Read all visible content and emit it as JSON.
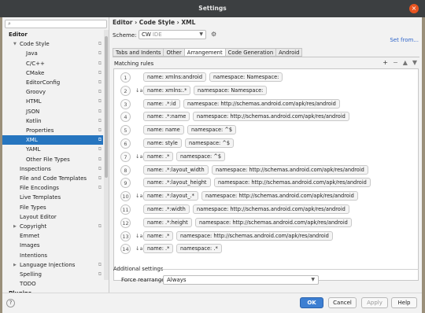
{
  "window": {
    "title": "Settings",
    "close_glyph": "×"
  },
  "sidebar": {
    "search_placeholder": "",
    "items": [
      {
        "label": "Editor",
        "level": 0,
        "bold": true
      },
      {
        "label": "Code Style",
        "level": 1,
        "expanded": true,
        "cfg": true
      },
      {
        "label": "Java",
        "level": 2,
        "cfg": true
      },
      {
        "label": "C/C++",
        "level": 2,
        "cfg": true
      },
      {
        "label": "CMake",
        "level": 2,
        "cfg": true
      },
      {
        "label": "EditorConfig",
        "level": 2,
        "cfg": true
      },
      {
        "label": "Groovy",
        "level": 2,
        "cfg": true
      },
      {
        "label": "HTML",
        "level": 2,
        "cfg": true
      },
      {
        "label": "JSON",
        "level": 2,
        "cfg": true
      },
      {
        "label": "Kotlin",
        "level": 2,
        "cfg": true
      },
      {
        "label": "Properties",
        "level": 2,
        "cfg": true
      },
      {
        "label": "XML",
        "level": 2,
        "cfg": true,
        "selected": true
      },
      {
        "label": "YAML",
        "level": 2,
        "cfg": true
      },
      {
        "label": "Other File Types",
        "level": 2,
        "cfg": true
      },
      {
        "label": "Inspections",
        "level": 1,
        "cfg": true
      },
      {
        "label": "File and Code Templates",
        "level": 1,
        "cfg": true
      },
      {
        "label": "File Encodings",
        "level": 1,
        "cfg": true
      },
      {
        "label": "Live Templates",
        "level": 1
      },
      {
        "label": "File Types",
        "level": 1
      },
      {
        "label": "Layout Editor",
        "level": 1
      },
      {
        "label": "Copyright",
        "level": 1,
        "collapsed": true,
        "cfg": true
      },
      {
        "label": "Emmet",
        "level": 1
      },
      {
        "label": "Images",
        "level": 1
      },
      {
        "label": "Intentions",
        "level": 1
      },
      {
        "label": "Language Injections",
        "level": 1,
        "collapsed": true,
        "cfg": true
      },
      {
        "label": "Spelling",
        "level": 1,
        "cfg": true
      },
      {
        "label": "TODO",
        "level": 1
      },
      {
        "label": "Plugins",
        "level": 0,
        "bold": true
      }
    ]
  },
  "main": {
    "breadcrumb": "Editor › Code Style › XML",
    "scheme_label": "Scheme:",
    "scheme_value": "CW",
    "scheme_suffix": "IDE",
    "set_from": "Set from...",
    "tabs": [
      "Tabs and Indents",
      "Other",
      "Arrangement",
      "Code Generation",
      "Android"
    ],
    "active_tab": 2,
    "matching_rules_label": "Matching rules",
    "tools": [
      "+",
      "−",
      "▲",
      "▼"
    ],
    "rules": [
      {
        "n": "1",
        "sort": false,
        "name": "name: xmlns:android",
        "ns": "namespace: Namespace:"
      },
      {
        "n": "2",
        "sort": true,
        "name": "name: xmlns:.*",
        "ns": "namespace: Namespace:"
      },
      {
        "n": "3",
        "sort": false,
        "name": "name: .*:id",
        "ns": "namespace: http://schemas.android.com/apk/res/android"
      },
      {
        "n": "4",
        "sort": false,
        "name": "name: .*:name",
        "ns": "namespace: http://schemas.android.com/apk/res/android"
      },
      {
        "n": "5",
        "sort": false,
        "name": "name: name",
        "ns": "namespace: ^$"
      },
      {
        "n": "6",
        "sort": false,
        "name": "name: style",
        "ns": "namespace: ^$"
      },
      {
        "n": "7",
        "sort": true,
        "name": "name: .*",
        "ns": "namespace: ^$"
      },
      {
        "n": "8",
        "sort": false,
        "name": "name: .*:layout_width",
        "ns": "namespace: http://schemas.android.com/apk/res/android"
      },
      {
        "n": "9",
        "sort": false,
        "name": "name: .*:layout_height",
        "ns": "namespace: http://schemas.android.com/apk/res/android"
      },
      {
        "n": "10",
        "sort": true,
        "name": "name: .*:layout_.*",
        "ns": "namespace: http://schemas.android.com/apk/res/android"
      },
      {
        "n": "11",
        "sort": false,
        "name": "name: .*:width",
        "ns": "namespace: http://schemas.android.com/apk/res/android"
      },
      {
        "n": "12",
        "sort": false,
        "name": "name: .*:height",
        "ns": "namespace: http://schemas.android.com/apk/res/android"
      },
      {
        "n": "13",
        "sort": true,
        "name": "name: .*",
        "ns": "namespace: http://schemas.android.com/apk/res/android"
      },
      {
        "n": "14",
        "sort": true,
        "name": "name: .*",
        "ns": "namespace: .*"
      }
    ],
    "sort_glyph": "↓a",
    "additional_settings": "Additional settings",
    "force_label": "Force rearrange:",
    "force_value": "Always"
  },
  "footer": {
    "help_glyph": "?",
    "ok": "OK",
    "cancel": "Cancel",
    "apply": "Apply",
    "help": "Help"
  },
  "colors": {
    "accent": "#2675bf",
    "primary_button": "#3d7fd2",
    "close": "#e95420"
  }
}
